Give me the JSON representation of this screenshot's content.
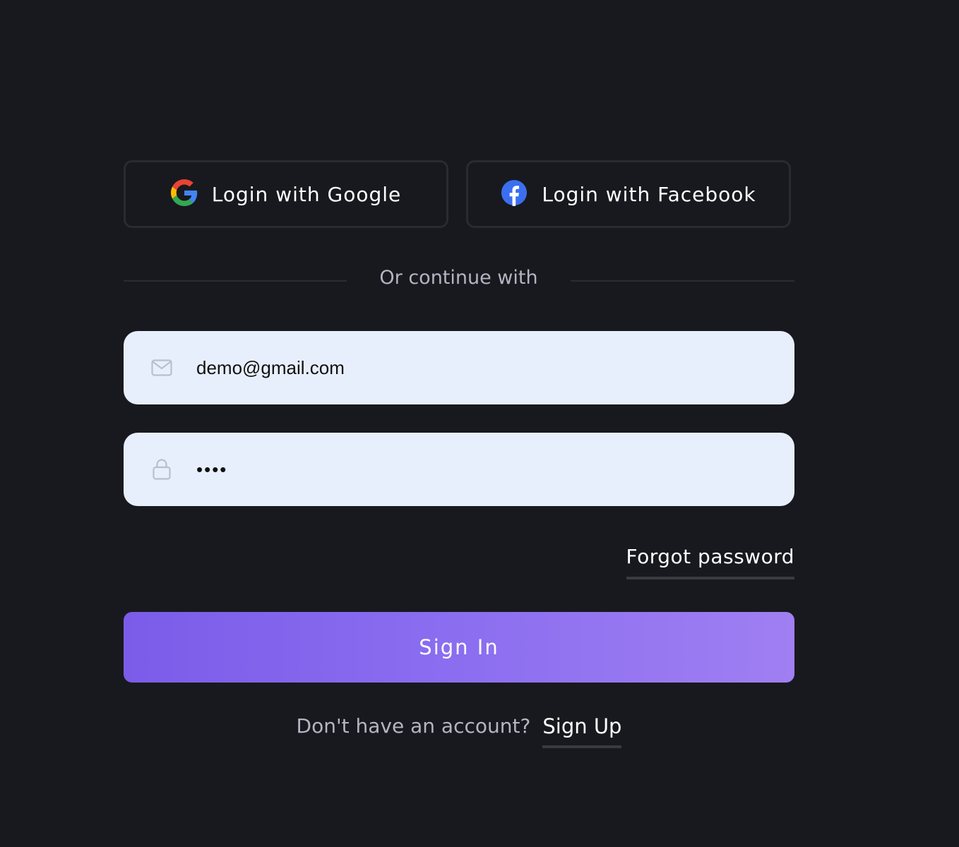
{
  "social": {
    "google_label": "Login with Google",
    "facebook_label": "Login with Facebook"
  },
  "divider": {
    "text": "Or continue with"
  },
  "form": {
    "email_value": "demo@gmail.com",
    "password_value": "demo"
  },
  "links": {
    "forgot_password": "Forgot password",
    "signup_prompt": "Don't have an account?",
    "signup_link": "Sign Up"
  },
  "actions": {
    "signin_label": "Sign In"
  },
  "colors": {
    "background": "#18191e",
    "field_background": "#e8effc",
    "accent_start": "#7b5ce9",
    "accent_end": "#a07ff2",
    "facebook_blue": "#3b6ff0"
  },
  "icons": {
    "google": "google-icon",
    "facebook": "facebook-icon",
    "email": "mail-icon",
    "password": "lock-icon"
  }
}
